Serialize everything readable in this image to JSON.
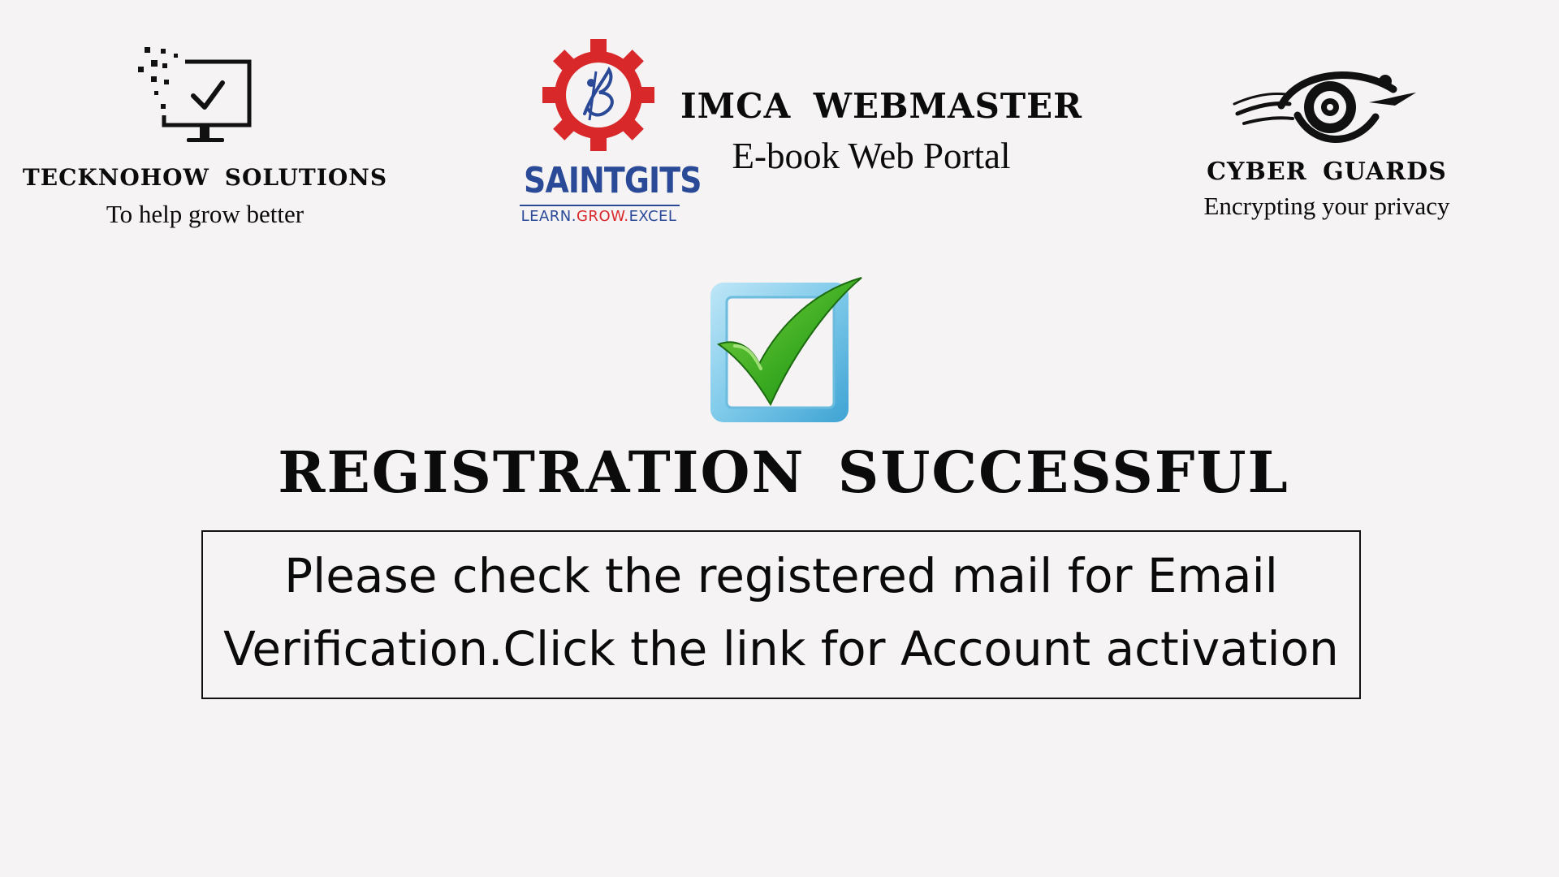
{
  "logos": {
    "left": {
      "icon": "monitor-check-icon",
      "title": "TECKNOHOW  SOLUTIONS",
      "tagline": "To help grow better"
    },
    "center": {
      "icon": "saintgits-gear-icon",
      "name": "SAINTGITS",
      "tagline_part1": "LEARN.",
      "tagline_part2": "GROW.",
      "tagline_part3": "EXCEL",
      "colors": {
        "blue": "#2a4a98",
        "red": "#d8282a"
      }
    },
    "right": {
      "icon": "cyber-eye-icon",
      "title": "CYBER  GUARDS",
      "tagline": "Encrypting your privacy"
    }
  },
  "portal": {
    "title": "IMCA  WEBMASTER",
    "subtitle": "E-book Web Portal"
  },
  "status": {
    "icon": "success-checkmark-icon",
    "heading": "REGISTRATION  SUCCESSFUL",
    "message_line1": "Please check the registered mail for Email",
    "message_line2": "Verification.Click the link for Account activation"
  }
}
